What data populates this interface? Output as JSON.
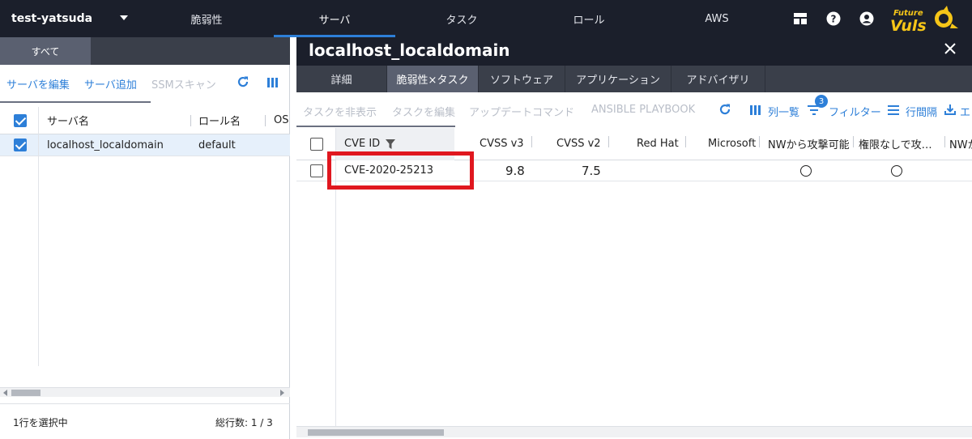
{
  "topbar": {
    "org_name": "test-yatsuda",
    "tabs": [
      {
        "label": "脆弱性"
      },
      {
        "label": "サーバ"
      },
      {
        "label": "タスク"
      },
      {
        "label": "ロール"
      },
      {
        "label": "AWS"
      }
    ],
    "active_tab": "サーバ",
    "icons": [
      "dashboard-icon",
      "help-icon",
      "account-icon"
    ],
    "logo": {
      "line1": "Future",
      "line2": "Vuls"
    }
  },
  "left": {
    "tab": "すべて",
    "toolbar": {
      "edit": "サーバを編集",
      "add": "サーバ追加",
      "ssm": "SSMスキャン"
    },
    "columns": {
      "name": "サーバ名",
      "role": "ロール名",
      "os": "OS"
    },
    "rows": [
      {
        "name": "localhost_localdomain",
        "role": "default"
      }
    ],
    "footer": {
      "selected": "1行を選択中",
      "total": "総行数: 1 / 3"
    }
  },
  "right": {
    "title": "localhost_localdomain",
    "tabs": [
      {
        "label": "詳細"
      },
      {
        "label": "脆弱性×タスク"
      },
      {
        "label": "ソフトウェア"
      },
      {
        "label": "アプリケーション"
      },
      {
        "label": "アドバイザリ"
      }
    ],
    "active_tab": "脆弱性×タスク",
    "toolbar": {
      "hide": "タスクを非表示",
      "edit": "タスクを編集",
      "update": "アップデートコマンド",
      "ansible": "ANSIBLE PLAYBOOK",
      "columns": "列一覧",
      "filter": "フィルター",
      "filter_count": "3",
      "spacing": "行間隔",
      "export": "エ"
    },
    "columns": {
      "cve": "CVE ID",
      "cvss3": "CVSS v3",
      "cvss2": "CVSS v2",
      "redhat": "Red Hat",
      "microsoft": "Microsoft",
      "nw": "NWから攻撃可能",
      "noauth": "権限なしで攻…",
      "nw2": "NWか"
    },
    "rows": [
      {
        "cve": "CVE-2020-25213",
        "cvss3": "9.8",
        "cvss2": "7.5",
        "nw": "○",
        "noauth": "○"
      }
    ]
  },
  "colors": {
    "topbar_bg": "#1b1f2b",
    "accent": "#2d7fd8",
    "highlight": "#e0171f",
    "selected_row": "#e6f0fb"
  }
}
